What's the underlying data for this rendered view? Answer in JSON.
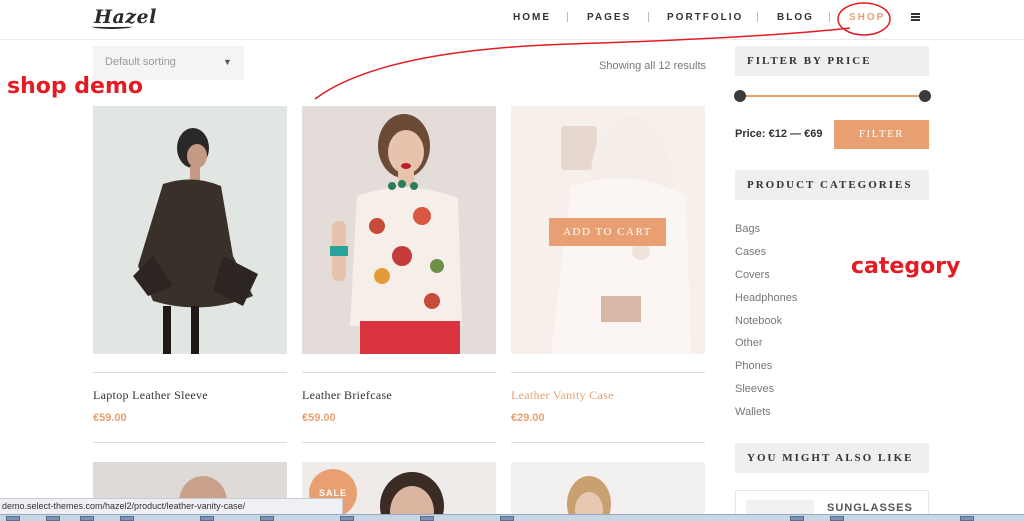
{
  "header": {
    "logo": "Hazel",
    "nav": [
      {
        "label": "HOME",
        "active": false
      },
      {
        "label": "PAGES",
        "active": false
      },
      {
        "label": "PORTFOLIO",
        "active": false
      },
      {
        "label": "BLOG",
        "active": false
      },
      {
        "label": "SHOP",
        "active": true
      }
    ],
    "menu_icon": "hamburger-icon"
  },
  "annotations": {
    "shop_demo": "shop demo",
    "category": "category",
    "color": "#e41b23"
  },
  "toolbar": {
    "sort_label": "Default sorting",
    "sort_icon": "chevron-down-icon",
    "results": "Showing all 12 results"
  },
  "products": [
    {
      "name": "Laptop Leather Sleeve",
      "price": "€59.00",
      "highlighted": false
    },
    {
      "name": "Leather Briefcase",
      "price": "€59.00",
      "highlighted": false
    },
    {
      "name": "Leather Vanity Case",
      "price": "€29.00",
      "highlighted": true,
      "add_to_cart": "ADD TO CART"
    }
  ],
  "second_row": {
    "sale_badge": "SALE"
  },
  "sidebar": {
    "filter_heading": "FILTER BY PRICE",
    "price_label": "Price: €12 — €69",
    "filter_button": "FILTER",
    "categories_heading": "PRODUCT CATEGORIES",
    "categories": [
      "Bags",
      "Cases",
      "Covers",
      "Headphones",
      "Notebook",
      "Other",
      "Phones",
      "Sleeves",
      "Wallets"
    ],
    "like_heading": "YOU MIGHT ALSO LIKE",
    "like_item": "SUNGLASSES"
  },
  "status_bar": "demo.select-themes.com/hazel2/product/leather-vanity-case/",
  "colors": {
    "accent": "#e8a073",
    "annotation": "#e41b23"
  }
}
